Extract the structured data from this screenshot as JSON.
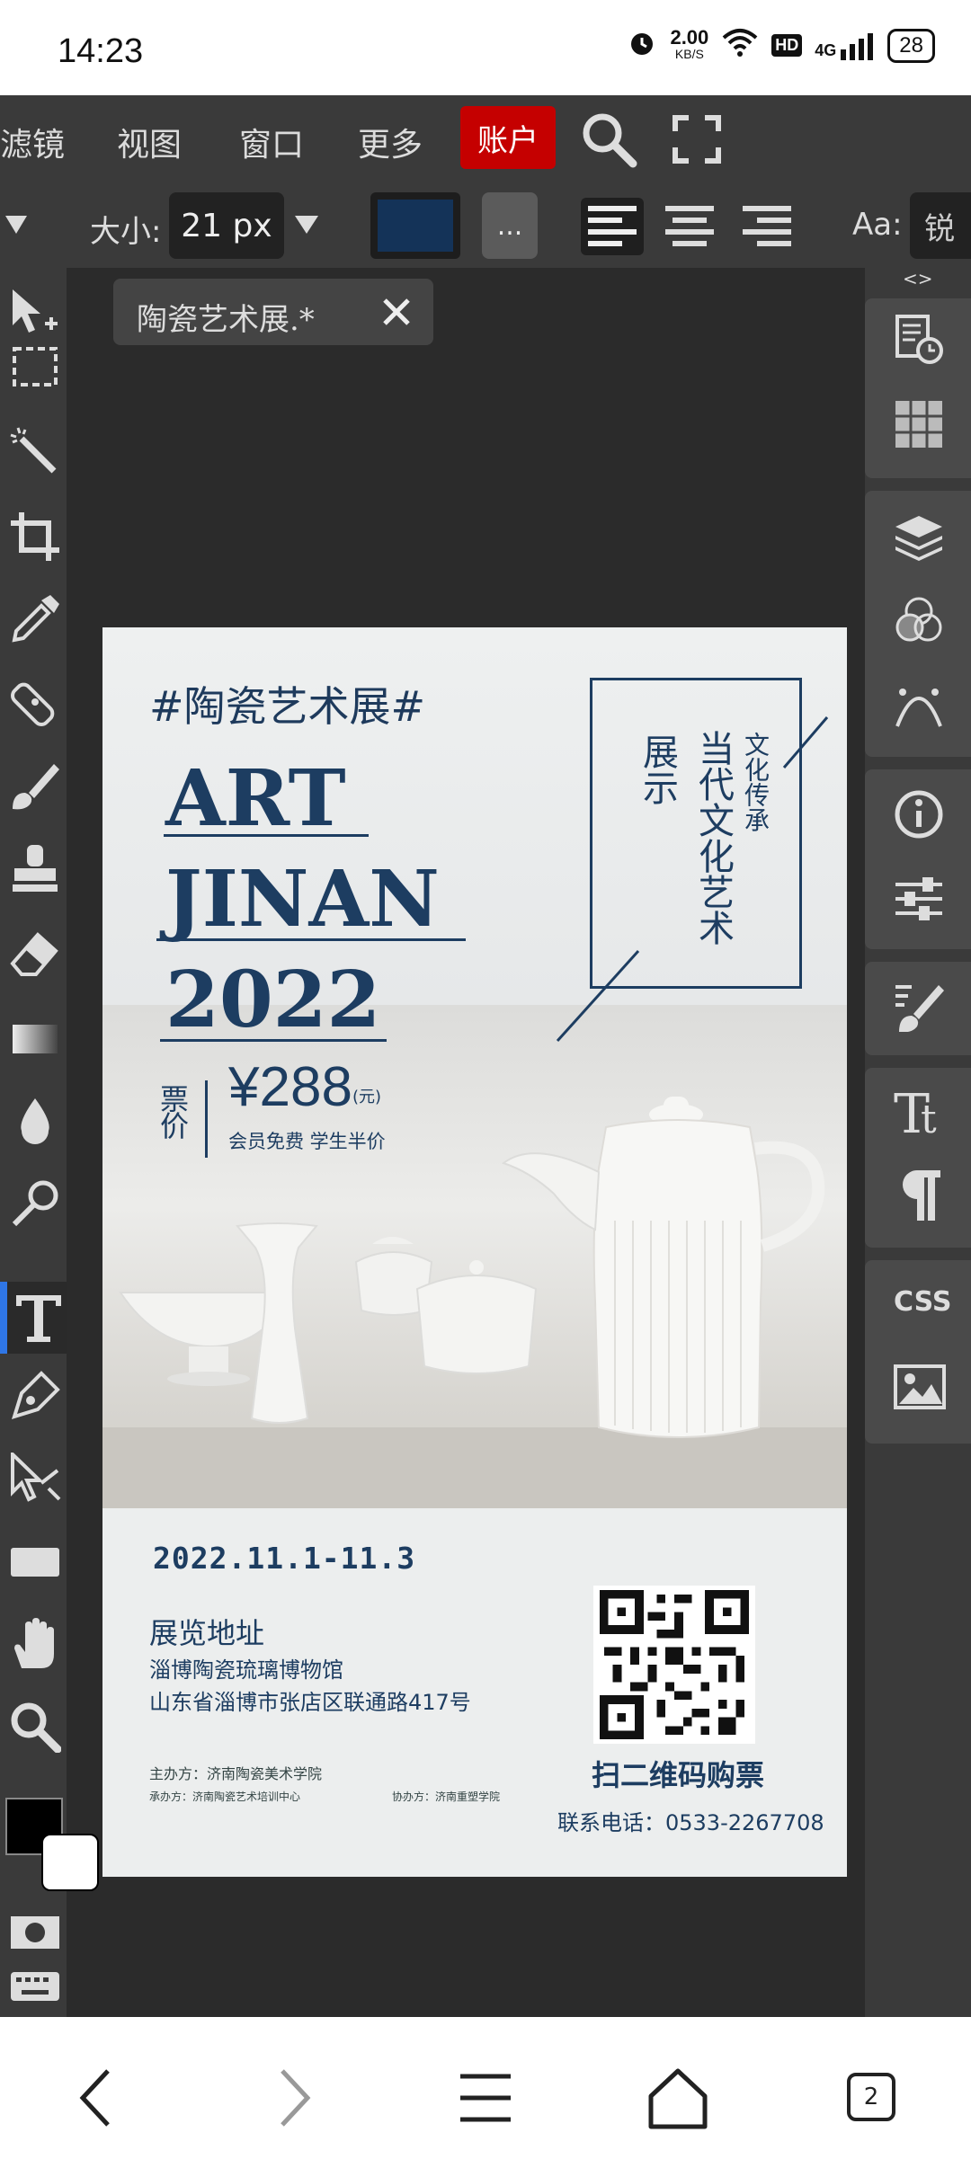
{
  "status": {
    "time": "14:23",
    "speed_value": "2.00",
    "speed_unit": "KB/S",
    "hd": "HD",
    "network": "4G",
    "battery": "28"
  },
  "menu": {
    "items": [
      "滤镜",
      "视图",
      "窗口",
      "更多"
    ],
    "account": "账户"
  },
  "options": {
    "size_label": "大小:",
    "size_value": "21 px",
    "font_label": "Aa:",
    "font_value": "锐",
    "more_label": "...",
    "text_color": "#143358"
  },
  "document": {
    "tab_title": "陶瓷艺术展.*"
  },
  "right_panel": {
    "collapse_label": "<>"
  },
  "poster": {
    "hashtag": "#陶瓷艺术展#",
    "title_line1": "ART",
    "title_line2": "JINAN",
    "title_line3": "2022",
    "vertical_1": "展示",
    "vertical_2": "当代文化艺术",
    "vertical_3": "文化传承",
    "ticket_label": "票价",
    "price": "¥288",
    "price_unit": "(元)",
    "member_note": "会员免费  学生半价",
    "dates": "2022.11.1-11.3",
    "address_title": "展览地址",
    "address_line1": "淄博陶瓷琉璃博物馆",
    "address_line2": "山东省淄博市张店区联通路417号",
    "organizer": "主办方：济南陶瓷美术学院",
    "co_organizer": "承办方：济南陶瓷艺术培训中心",
    "assist": "协办方：济南重塑学院",
    "scan_label": "扫二维码购票",
    "phone": "联系电话：0533-2267708"
  },
  "bottom_nav": {
    "tabs_count": "2"
  },
  "colors": {
    "accent_red": "#c50000",
    "selection_blue": "#2f76e6",
    "poster_navy": "#1d3d61"
  }
}
